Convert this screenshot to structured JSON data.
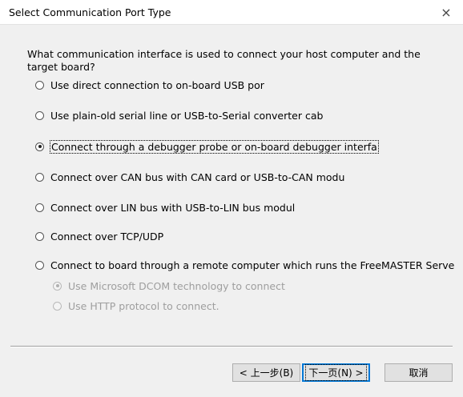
{
  "window": {
    "title": "Select Communication Port Type",
    "close_glyph": "×"
  },
  "prompt": "What communication interface is used to connect your host computer and the target board?",
  "options": [
    {
      "label": "Use direct connection to on-board USB por",
      "checked": false
    },
    {
      "label": "Use plain-old serial line or USB-to-Serial converter cab",
      "checked": false
    },
    {
      "label": "Connect through a debugger probe or on-board debugger interfa",
      "checked": true
    },
    {
      "label": "Connect over CAN bus with CAN card or USB-to-CAN modu",
      "checked": false
    },
    {
      "label": "Connect over LIN bus with USB-to-LIN bus modul",
      "checked": false
    },
    {
      "label": "Connect over TCP/UDP",
      "checked": false
    },
    {
      "label": "Connect to board through a remote computer which runs the FreeMASTER Serve",
      "checked": false
    }
  ],
  "sub_options": [
    {
      "label": "Use Microsoft DCOM technology to connect",
      "checked": true,
      "disabled": true
    },
    {
      "label": "Use HTTP protocol to connect.",
      "checked": false,
      "disabled": true
    }
  ],
  "buttons": {
    "back": "< 上一步(B)",
    "next": "下一页(N) >",
    "cancel": "取消"
  }
}
